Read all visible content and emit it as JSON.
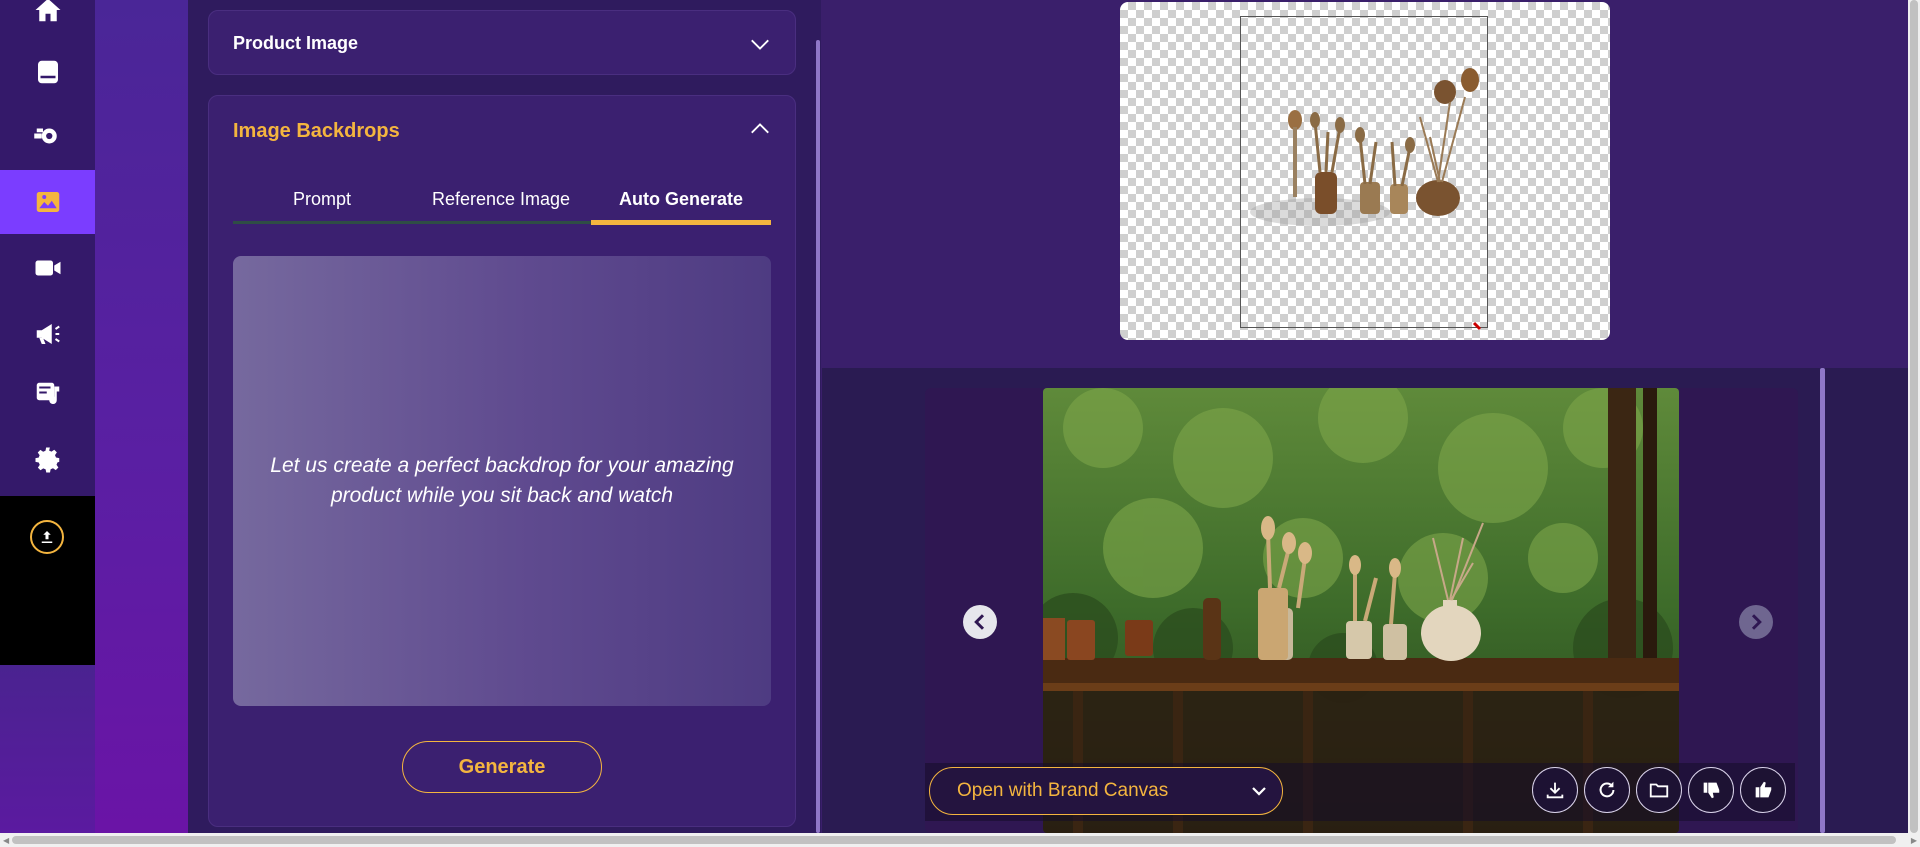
{
  "sidebar": {
    "items": [
      {
        "icon": "home-icon"
      },
      {
        "icon": "book-icon"
      },
      {
        "icon": "gear-arrow-icon"
      },
      {
        "icon": "image-icon",
        "active": true
      },
      {
        "icon": "video-icon"
      },
      {
        "icon": "megaphone-icon"
      },
      {
        "icon": "notes-icon"
      },
      {
        "icon": "settings-icon"
      }
    ],
    "upload_icon": "upload-icon"
  },
  "panel": {
    "product_image_title": "Product Image",
    "backdrops_title": "Image Backdrops",
    "tabs": [
      {
        "label": "Prompt"
      },
      {
        "label": "Reference Image"
      },
      {
        "label": "Auto Generate",
        "active": true
      }
    ],
    "auto_generate_text": "Let us create a perfect backdrop for your amazing product while you sit back and watch",
    "generate_label": "Generate"
  },
  "preview": {
    "brand_canvas_label": "Open with Brand Canvas",
    "actions": [
      "download-icon",
      "refresh-icon",
      "folder-icon",
      "thumbs-down-icon",
      "thumbs-up-icon"
    ]
  },
  "colors": {
    "accent": "#f4b53f",
    "active_nav": "#7b3dff",
    "panel": "#3b2070"
  }
}
